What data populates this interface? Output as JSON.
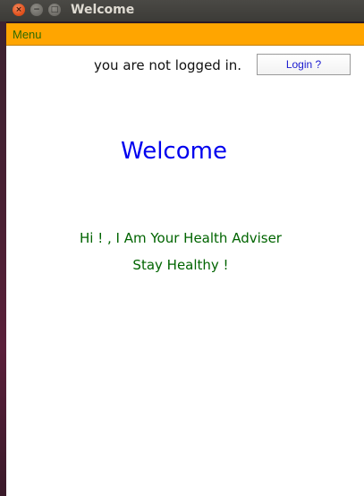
{
  "window": {
    "title": "Welcome",
    "close_glyph": "×",
    "min_glyph": "−",
    "max_glyph": "□"
  },
  "menubar": {
    "menu_label": "Menu"
  },
  "header": {
    "status_text": "you are not logged in.",
    "login_label": "Login ?"
  },
  "main": {
    "heading": "Welcome",
    "line1": "Hi ! , I Am Your Health Adviser",
    "line2": "Stay Healthy !"
  },
  "colors": {
    "menubar_bg": "#ffa500",
    "menu_text": "#2e6b00",
    "heading": "#0000ee",
    "greeting": "#006400",
    "login_text": "#1a1ad0"
  }
}
